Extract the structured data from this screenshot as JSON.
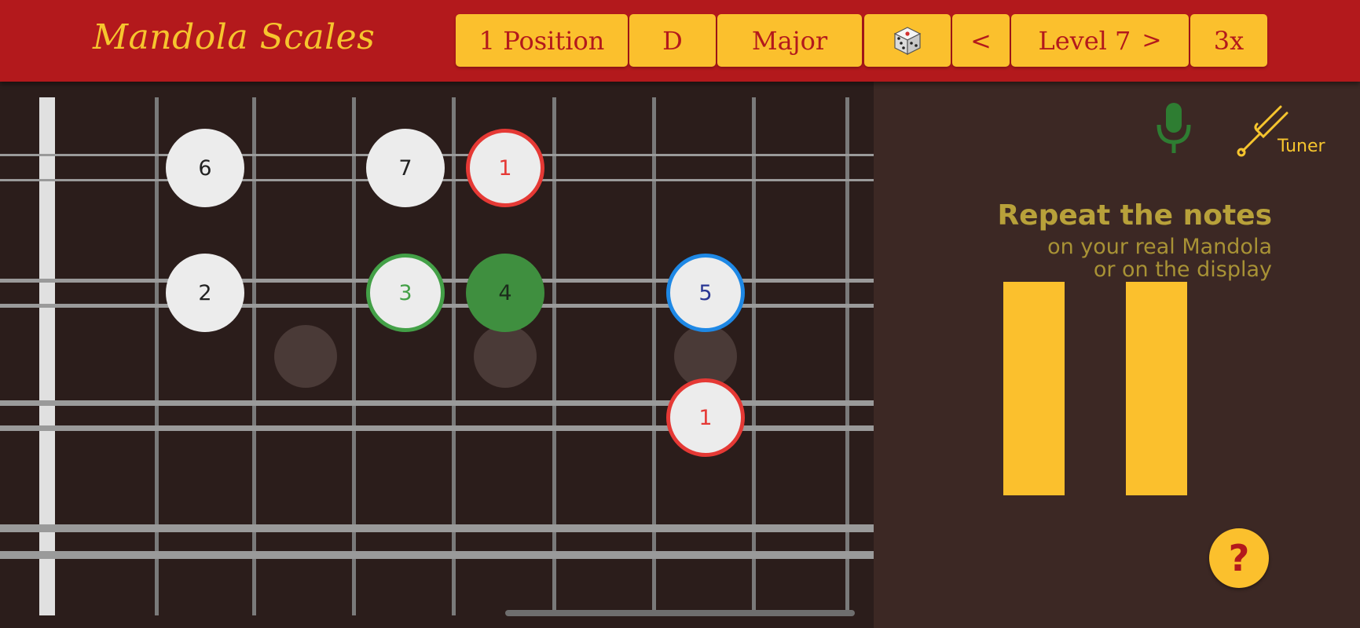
{
  "header": {
    "title": "Mandola Scales",
    "position_label": "1 Position",
    "key_label": "D",
    "scale_label": "Major",
    "dice_icon": "dice-icon",
    "prev_label": "<",
    "level_label": "Level 7",
    "next_label": ">",
    "speed_label": "3x"
  },
  "colors": {
    "header_bg": "#b3191c",
    "accent": "#fbc02d",
    "root_note": "#e53935",
    "current_note": "#43a047",
    "next_note": "#1e88e5",
    "panel_bg": "#3c2824",
    "fretboard_bg": "#2b1d1b"
  },
  "fretboard": {
    "notes": {
      "n1": "6",
      "n2": "7",
      "n3": "1",
      "n4": "2",
      "n5": "3",
      "n6": "4",
      "n7": "5",
      "n8": "1"
    }
  },
  "panel": {
    "mic_icon": "microphone-icon",
    "tuner_icon": "tuning-fork-icon",
    "tuner_label": "Tuner",
    "instruction_title": "Repeat the notes",
    "instruction_line1": "on your real Mandola",
    "instruction_line2": "or on the display",
    "pause_icon": "pause-icon",
    "help_label": "?"
  }
}
